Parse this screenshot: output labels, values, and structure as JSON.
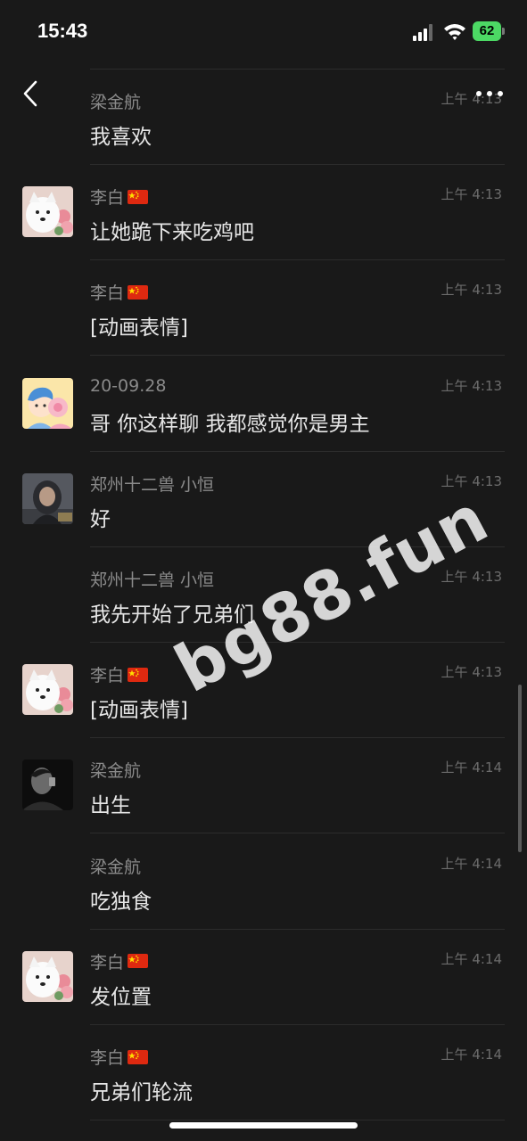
{
  "status_bar": {
    "time": "15:43",
    "battery": "62"
  },
  "messages": [
    {
      "sender": "梁金航",
      "flag": false,
      "time": "上午 4:13",
      "text": "我喜欢",
      "avatar": null
    },
    {
      "sender": "李白",
      "flag": true,
      "time": "上午 4:13",
      "text": "让她跪下来吃鸡吧",
      "avatar": "dog-avatar"
    },
    {
      "sender": "李白",
      "flag": true,
      "time": "上午 4:13",
      "text": "[动画表情]",
      "avatar": null
    },
    {
      "sender": "20-09.28",
      "flag": false,
      "time": "上午 4:13",
      "text": "哥 你这样聊  我都感觉你是男主",
      "avatar": "cartoon-couple-avatar"
    },
    {
      "sender": "郑州十二兽  小恒",
      "flag": false,
      "time": "上午 4:13",
      "text": "好",
      "avatar": "hooded-person-avatar"
    },
    {
      "sender": "郑州十二兽  小恒",
      "flag": false,
      "time": "上午 4:13",
      "text": "我先开始了兄弟们",
      "avatar": null
    },
    {
      "sender": "李白",
      "flag": true,
      "time": "上午 4:13",
      "text": "[动画表情]",
      "avatar": "dog-avatar"
    },
    {
      "sender": "梁金航",
      "flag": false,
      "time": "上午 4:14",
      "text": "出生",
      "avatar": "bw-portrait-avatar"
    },
    {
      "sender": "梁金航",
      "flag": false,
      "time": "上午 4:14",
      "text": "吃独食",
      "avatar": null
    },
    {
      "sender": "李白",
      "flag": true,
      "time": "上午 4:14",
      "text": "发位置",
      "avatar": "dog-avatar"
    },
    {
      "sender": "李白",
      "flag": true,
      "time": "上午 4:14",
      "text": "兄弟们轮流",
      "avatar": null
    }
  ],
  "watermark": "bg88.fun",
  "colors": {
    "background": "#191919",
    "sender": "#8a8a8a",
    "message": "#e6e6e6",
    "time": "#6c6c6c",
    "battery": "#4cd964"
  }
}
